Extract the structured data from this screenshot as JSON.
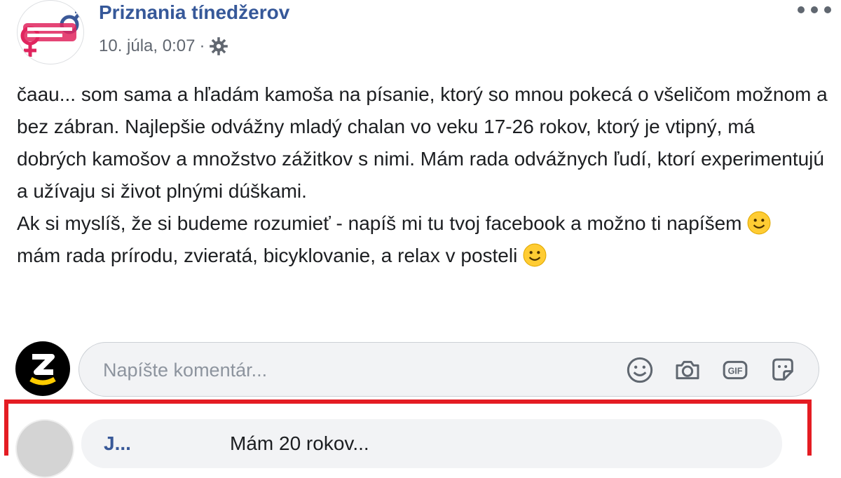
{
  "post": {
    "page_name": "Priznania tínedžerov",
    "timestamp": "10. júla, 0:07",
    "separator": "·",
    "privacy_icon": "gear-icon",
    "more_icon": "more-options-icon",
    "paragraphs": [
      "čaau... som sama a hľadám kamoša na písanie, ktorý so mnou pokecá o všeličom možnom a bez zábran. Najlepšie odvážny mladý chalan vo veku 17-26 rokov, ktorý je vtipný, má dobrých kamošov a množstvo zážitkov s nimi. Mám rada odvážnych ľudí, ktorí experimentujú a užívaju si život plnými dúškami.",
      "Ak si myslíš, že si budeme rozumieť - napíš mi tu tvoj facebook a možno ti napíšem",
      "mám rada prírodu, zvieratá, bicyklovanie, a relax v posteli"
    ]
  },
  "composer": {
    "placeholder": "Napíšte komentár...",
    "icons": [
      "emoji-icon",
      "camera-icon",
      "gif-icon",
      "sticker-icon"
    ]
  },
  "reply": {
    "author": "J...",
    "text": "Mám 20 rokov..."
  },
  "colors": {
    "link": "#365899",
    "highlight": "#e41c23",
    "bubble": "#f2f3f5"
  }
}
